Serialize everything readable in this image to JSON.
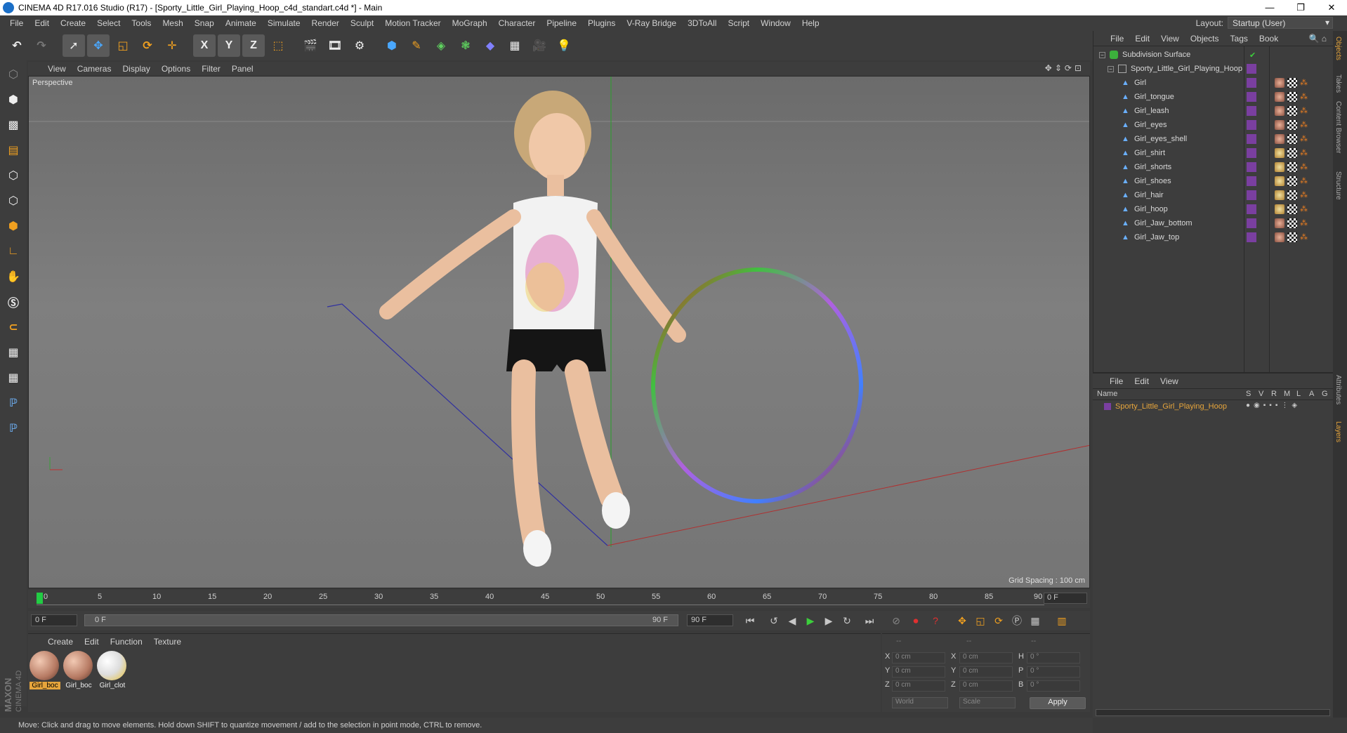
{
  "window": {
    "title": "CINEMA 4D R17.016 Studio (R17) - [Sporty_Little_Girl_Playing_Hoop_c4d_standart.c4d *] - Main",
    "min": "—",
    "max": "❐",
    "close": "✕"
  },
  "menu": [
    "File",
    "Edit",
    "Create",
    "Select",
    "Tools",
    "Mesh",
    "Snap",
    "Animate",
    "Simulate",
    "Render",
    "Sculpt",
    "Motion Tracker",
    "MoGraph",
    "Character",
    "Pipeline",
    "Plugins",
    "V-Ray Bridge",
    "3DToAll",
    "Script",
    "Window",
    "Help"
  ],
  "layout": {
    "label": "Layout:",
    "value": "Startup (User)"
  },
  "toolbar": {
    "x": "X",
    "y": "Y",
    "z": "Z"
  },
  "viewport": {
    "menu": [
      "View",
      "Cameras",
      "Display",
      "Options",
      "Filter",
      "Panel"
    ],
    "label": "Perspective",
    "grid_spacing": "Grid Spacing : 100 cm"
  },
  "timeline": {
    "ticks": [
      "0",
      "5",
      "10",
      "15",
      "20",
      "25",
      "30",
      "35",
      "40",
      "45",
      "50",
      "55",
      "60",
      "65",
      "70",
      "75",
      "80",
      "85",
      "90"
    ],
    "frame": "0 F"
  },
  "transport": {
    "start": "0 F",
    "range_start": "0 F",
    "range_end": "90 F",
    "end": "90 F"
  },
  "materials": {
    "menu": [
      "Create",
      "Edit",
      "Function",
      "Texture"
    ],
    "items": [
      "Girl_boc",
      "Girl_boc",
      "Girl_clot"
    ]
  },
  "coords": {
    "labels": [
      "X",
      "Y",
      "Z"
    ],
    "labels2": [
      "X",
      "Y",
      "Z"
    ],
    "labels3": [
      "H",
      "P",
      "B"
    ],
    "val": "0 cm",
    "rot": "0 °",
    "world": "World",
    "scale": "Scale",
    "apply": "Apply",
    "dash": "--"
  },
  "status": "Move: Click and drag to move elements. Hold down SHIFT to quantize movement / add to the selection in point mode, CTRL to remove.",
  "objects": {
    "menu": [
      "File",
      "Edit",
      "View",
      "Objects",
      "Tags",
      "Book"
    ],
    "root": "Subdivision Surface",
    "group": "Sporty_Little_Girl_Playing_Hoop",
    "items": [
      "Girl",
      "Girl_tongue",
      "Girl_leash",
      "Girl_eyes",
      "Girl_eyes_shell",
      "Girl_shirt",
      "Girl_shorts",
      "Girl_shoes",
      "Girl_hair",
      "Girl_hoop",
      "Girl_Jaw_bottom",
      "Girl_Jaw_top"
    ]
  },
  "layers": {
    "menu": [
      "File",
      "Edit",
      "View"
    ],
    "headers": {
      "name": "Name",
      "cols": [
        "S",
        "V",
        "R",
        "M",
        "L",
        "A",
        "G"
      ]
    },
    "row": "Sporty_Little_Girl_Playing_Hoop"
  },
  "sidetabs": [
    "Objects",
    "Takes",
    "Content Browser",
    "Structure",
    "Attributes",
    "Layers"
  ],
  "brand": {
    "maxon": "MAXON",
    "c4d": "CINEMA 4D"
  },
  "colors": {
    "accent": "#e6a53c",
    "panel": "#3d3d3d",
    "layer": "#7a3fa0"
  }
}
